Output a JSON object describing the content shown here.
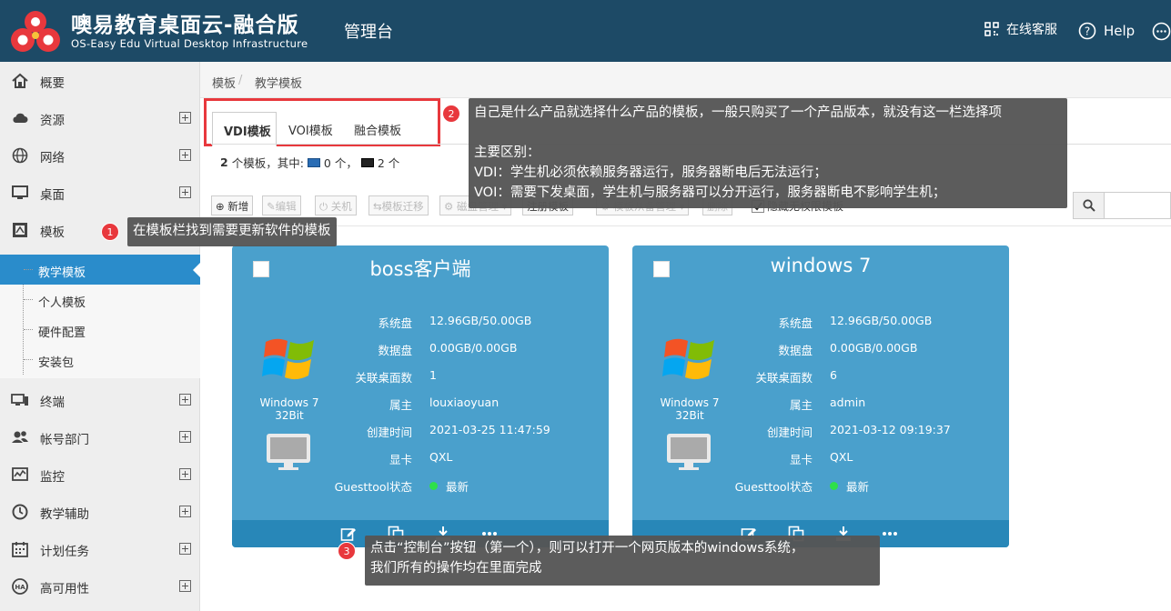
{
  "header": {
    "title": "噢易教育桌面云-融合版",
    "subtitle": "OS-Easy Edu Virtual Desktop Infrastructure",
    "section": "管理台",
    "support": "在线客服",
    "help": "Help",
    "bg_color": "#1d4a66"
  },
  "sidebar": {
    "items": [
      {
        "label": "概要",
        "icon": "home-icon"
      },
      {
        "label": "资源",
        "icon": "cloud-icon"
      },
      {
        "label": "网络",
        "icon": "globe-icon"
      },
      {
        "label": "桌面",
        "icon": "desktop-icon"
      },
      {
        "label": "模板",
        "icon": "template-icon"
      },
      {
        "label": "终端",
        "icon": "terminal-icon"
      },
      {
        "label": "帐号部门",
        "icon": "users-icon"
      },
      {
        "label": "监控",
        "icon": "monitor-chart-icon"
      },
      {
        "label": "教学辅助",
        "icon": "clock-icon"
      },
      {
        "label": "计划任务",
        "icon": "calendar-icon"
      },
      {
        "label": "高可用性",
        "icon": "ha-icon"
      }
    ],
    "sub_items": [
      "教学模板",
      "个人模板",
      "硬件配置",
      "安装包"
    ],
    "active_sub": "教学模板"
  },
  "breadcrumb": [
    "模板",
    "/",
    "教学模板"
  ],
  "tabs": [
    "VDI模板",
    "VOI模板",
    "融合模板"
  ],
  "summary": {
    "count": "2",
    "text1": "个模板，其中:",
    "vdi_count": "0 个，",
    "voi_count": "2 个"
  },
  "toolbar": {
    "new": "新增",
    "edit": "编辑",
    "shutdown": "关机",
    "migrate": "模板迁移",
    "disk": "磁盘管理",
    "register": "注册模板",
    "restore": "模板从备管理",
    "delete": "删除",
    "hide": "隐藏无权限模板"
  },
  "cards": [
    {
      "title": "boss客户端",
      "os": "Windows 7",
      "bits": "32Bit",
      "rows": [
        {
          "k": "系统盘",
          "v": "12.96GB/50.00GB"
        },
        {
          "k": "数据盘",
          "v": "0.00GB/0.00GB"
        },
        {
          "k": "关联桌面数",
          "v": "1"
        },
        {
          "k": "属主",
          "v": "louxiaoyuan"
        },
        {
          "k": "创建时间",
          "v": "2021-03-25 11:47:59"
        },
        {
          "k": "显卡",
          "v": "QXL"
        },
        {
          "k": "Guesttool状态",
          "v": "最新"
        }
      ]
    },
    {
      "title": "windows 7",
      "os": "Windows 7",
      "bits": "32Bit",
      "rows": [
        {
          "k": "系统盘",
          "v": "12.96GB/50.00GB"
        },
        {
          "k": "数据盘",
          "v": "0.00GB/0.00GB"
        },
        {
          "k": "关联桌面数",
          "v": "6"
        },
        {
          "k": "属主",
          "v": "admin"
        },
        {
          "k": "创建时间",
          "v": "2021-03-12 09:19:37"
        },
        {
          "k": "显卡",
          "v": "QXL"
        },
        {
          "k": "Guesttool状态",
          "v": "最新"
        }
      ]
    }
  ],
  "annotations": {
    "a1": {
      "num": "1",
      "text": "在模板栏找到需要更新软件的模板"
    },
    "a2": {
      "num": "2",
      "line1": "自己是什么产品就选择什么产品的模板，一般只购买了一个产品版本，就没有这一栏选择项",
      "line2": "主要区别：",
      "line3": "VDI：学生机必须依赖服务器运行，服务器断电后无法运行；",
      "line4": "VOI：需要下发桌面，学生机与服务器可以分开运行，服务器断电不影响学生机；"
    },
    "a3": {
      "num": "3",
      "line1": "点击“控制台”按钮（第一个），则可以打开一个网页版本的windows系统，",
      "line2": "我们所有的操作均在里面完成"
    }
  }
}
